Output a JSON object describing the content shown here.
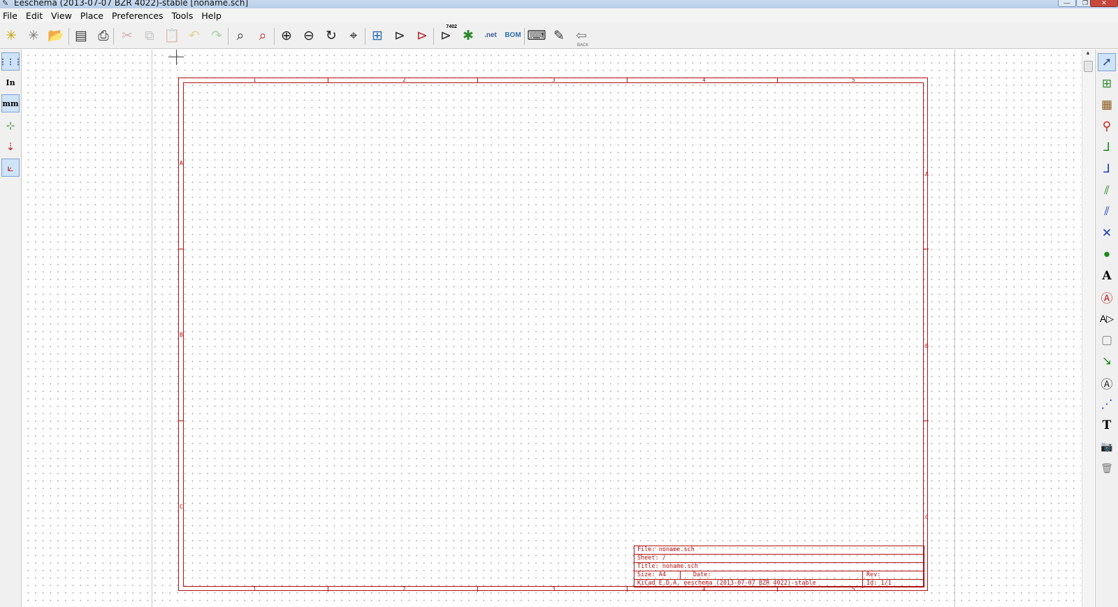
{
  "window": {
    "title": "Eeschema (2013-07-07 BZR 4022)-stable [noname.sch]",
    "minimize_glyph": "—",
    "maximize_glyph": "❐",
    "close_glyph": "✕"
  },
  "menu": [
    "File",
    "Edit",
    "View",
    "Place",
    "Preferences",
    "Tools",
    "Help"
  ],
  "toolbar": [
    {
      "icon": "new-schematic-icon",
      "glyph": "✳",
      "color": "#c9a100"
    },
    {
      "icon": "new-sheet-icon",
      "glyph": "✳",
      "color": "#7a7a7a"
    },
    {
      "icon": "open-schematic-icon",
      "glyph": "📂",
      "color": "#3f6fb5"
    },
    {
      "icon": "page-settings-icon",
      "glyph": "▤",
      "color": "#333"
    },
    {
      "icon": "print-icon",
      "glyph": "⎙",
      "color": "#333"
    },
    {
      "icon": "cut-icon",
      "glyph": "✂",
      "color": "#b03030",
      "disabled": true
    },
    {
      "icon": "copy-icon",
      "glyph": "⧉",
      "color": "#777",
      "disabled": true
    },
    {
      "icon": "paste-icon",
      "glyph": "📋",
      "color": "#777",
      "disabled": true
    },
    {
      "icon": "undo-icon",
      "glyph": "↶",
      "color": "#c9a100",
      "disabled": true
    },
    {
      "icon": "redo-icon",
      "glyph": "↷",
      "color": "#2c9a2c",
      "disabled": true
    },
    {
      "icon": "find-icon",
      "glyph": "⌕",
      "color": "#333"
    },
    {
      "icon": "find-replace-icon",
      "glyph": "⌕",
      "color": "#b03030"
    },
    {
      "icon": "zoom-in-icon",
      "glyph": "⊕",
      "color": "#222"
    },
    {
      "icon": "zoom-out-icon",
      "glyph": "⊖",
      "color": "#222"
    },
    {
      "icon": "redraw-icon",
      "glyph": "↻",
      "color": "#222"
    },
    {
      "icon": "zoom-fit-icon",
      "glyph": "⌖",
      "color": "#222"
    },
    {
      "icon": "hierarchy-navigator-icon",
      "glyph": "⊞",
      "color": "#2e6fb0"
    },
    {
      "icon": "library-editor-icon",
      "glyph": "⊳",
      "color": "#333"
    },
    {
      "icon": "library-browser-icon",
      "glyph": "⊳",
      "color": "#b03030"
    },
    {
      "icon": "annotate-icon",
      "glyph": "⊳",
      "color": "#333",
      "badge": "7402"
    },
    {
      "icon": "erc-icon",
      "glyph": "✱",
      "color": "#2c8a2c"
    },
    {
      "icon": "netlist-icon",
      "glyph": ".net",
      "color": "#3a5fa0",
      "small": true
    },
    {
      "icon": "bom-icon",
      "glyph": "BOM",
      "color": "#2e6fb0",
      "small": true
    },
    {
      "icon": "cvpcb-icon",
      "glyph": "⌨",
      "color": "#333"
    },
    {
      "icon": "pcbnew-icon",
      "glyph": "✎",
      "color": "#333"
    },
    {
      "icon": "back-annotate-icon",
      "glyph": "⇦",
      "color": "#777",
      "label": "BACK"
    }
  ],
  "left_toolbar": [
    {
      "icon": "grid-toggle-icon",
      "glyph": "⋮⋮⋮",
      "color": "#2e4f9a",
      "active": true
    },
    {
      "icon": "units-inch-icon",
      "glyph": "In",
      "color": "#000"
    },
    {
      "icon": "units-mm-icon",
      "glyph": "mm",
      "color": "#000",
      "active": true
    },
    {
      "icon": "cursor-shape-icon",
      "glyph": "⊹",
      "color": "#2c8a2c"
    },
    {
      "icon": "hidden-pins-icon",
      "glyph": "⇣",
      "color": "#c02020"
    },
    {
      "icon": "bus-wire-angle-icon",
      "glyph": "⟀",
      "color": "#b03030",
      "active": true
    }
  ],
  "right_toolbar": [
    {
      "icon": "select-cursor-icon",
      "glyph": "➚",
      "color": "#2e4f9a",
      "active": true
    },
    {
      "icon": "hierarchy-push-pop-icon",
      "glyph": "⊞",
      "color": "#2c8a2c"
    },
    {
      "icon": "add-component-icon",
      "glyph": "▦",
      "color": "#8a5a1a"
    },
    {
      "icon": "add-power-icon",
      "glyph": "⚲",
      "color": "#c02020"
    },
    {
      "icon": "add-wire-icon",
      "glyph": "⅃",
      "color": "#1a8a1a"
    },
    {
      "icon": "add-bus-icon",
      "glyph": "⅃",
      "color": "#1a3ac0"
    },
    {
      "icon": "wire-bus-entry-icon",
      "glyph": "⫽",
      "color": "#1a8a1a"
    },
    {
      "icon": "bus-bus-entry-icon",
      "glyph": "⫽",
      "color": "#1a3ac0"
    },
    {
      "icon": "no-connect-icon",
      "glyph": "✕",
      "color": "#1a3ac0"
    },
    {
      "icon": "add-junction-icon",
      "glyph": "●",
      "color": "#1a8a1a"
    },
    {
      "icon": "net-label-icon",
      "glyph": "A",
      "color": "#000"
    },
    {
      "icon": "global-label-icon",
      "glyph": "Ⓐ",
      "color": "#c02020"
    },
    {
      "icon": "hierarchical-label-icon",
      "glyph": "A▷",
      "color": "#000"
    },
    {
      "icon": "hierarchical-sheet-icon",
      "glyph": "▢",
      "color": "#888"
    },
    {
      "icon": "import-sheet-pin-icon",
      "glyph": "↘",
      "color": "#1a8a1a"
    },
    {
      "icon": "add-sheet-pin-icon",
      "glyph": "Ⓐ",
      "color": "#333"
    },
    {
      "icon": "add-graphic-line-icon",
      "glyph": "⋰",
      "color": "#1a3ac0"
    },
    {
      "icon": "add-text-icon",
      "glyph": "T",
      "color": "#000"
    },
    {
      "icon": "add-image-icon",
      "glyph": "📷",
      "color": "#555"
    },
    {
      "icon": "delete-item-icon",
      "glyph": "🗑",
      "color": "#777"
    }
  ],
  "sheet": {
    "column_labels": [
      "1",
      "2",
      "3",
      "4",
      "5"
    ],
    "row_labels": [
      "A",
      "B",
      "C"
    ]
  },
  "title_block": {
    "file": "File: noname.sch",
    "sheet": "Sheet: /",
    "title": "Title: noname.sch",
    "size": "Size: A4",
    "date": "Date:",
    "rev": "Rev:",
    "credit": "KiCad E.D.A.  eeschema (2013-07-07 BZR 4022)-stable",
    "id": "Id: 1/1"
  }
}
